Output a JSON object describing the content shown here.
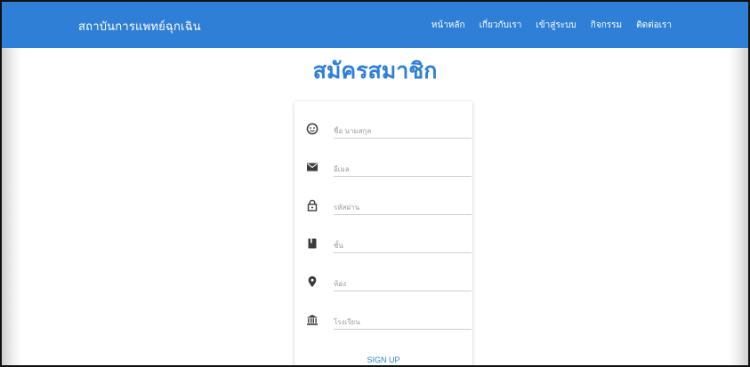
{
  "navbar": {
    "brand": "สถาบันการแพทย์ฉุกเฉิน",
    "links": [
      "หน้าหลัก",
      "เกี่ยวกับเรา",
      "เข้าสู่ระบบ",
      "กิจกรรม",
      "ติดต่อเรา"
    ]
  },
  "colors": {
    "accent": "#2f7fd7"
  },
  "main": {
    "title": "สมัครสมาชิก"
  },
  "form": {
    "fields": [
      {
        "icon": "face-icon",
        "placeholder": "ชื่อ นามสกุล",
        "value": ""
      },
      {
        "icon": "email-icon",
        "placeholder": "อีเมล",
        "value": ""
      },
      {
        "icon": "lock-icon",
        "placeholder": "รหัสผ่าน",
        "value": ""
      },
      {
        "icon": "book-icon",
        "placeholder": "ชั้น",
        "value": ""
      },
      {
        "icon": "location-pin-icon",
        "placeholder": "ห้อง",
        "value": ""
      },
      {
        "icon": "bank-icon",
        "placeholder": "โรงเรียน",
        "value": ""
      }
    ],
    "submit_label": "SIGN UP"
  }
}
